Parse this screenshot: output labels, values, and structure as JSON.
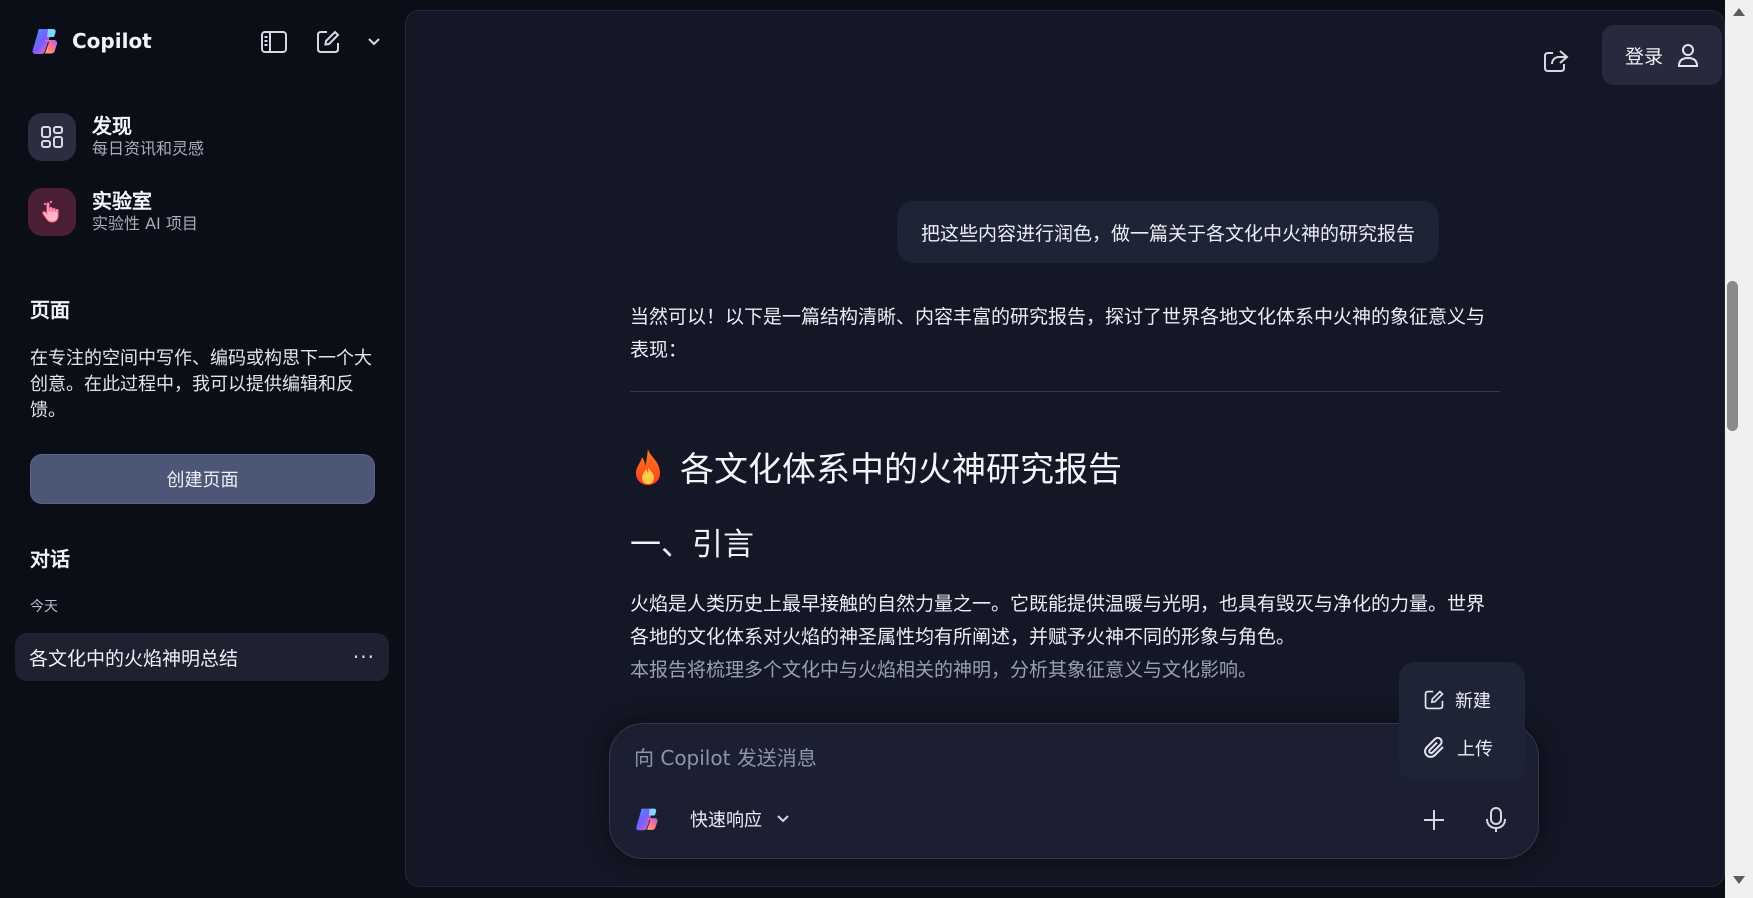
{
  "brand": {
    "name": "Copilot",
    "logo_icon": "copilot-logo-icon"
  },
  "sidebar": {
    "tools": [
      "sidebar-toggle-icon",
      "new-chat-icon",
      "chevron-down-icon"
    ],
    "discover": {
      "title": "发现",
      "subtitle": "每日资讯和灵感",
      "icon": "grid-icon"
    },
    "labs": {
      "title": "实验室",
      "subtitle": "实验性 AI 项目",
      "icon": "pointer-hand-icon"
    },
    "pages": {
      "title": "页面",
      "description": "在专注的空间中写作、编码或构思下一个大创意。在此过程中，我可以提供编辑和反馈。",
      "create_button": "创建页面"
    },
    "conversations": {
      "title": "对话",
      "today_label": "今天",
      "items": [
        {
          "title": "各文化中的火焰神明总结",
          "more": "···"
        }
      ]
    }
  },
  "header": {
    "share_icon": "share-icon",
    "login_label": "登录",
    "user_icon": "user-icon"
  },
  "chat": {
    "user_message": "把这些内容进行润色，做一篇关于各文化中火神的研究报告",
    "answer": {
      "intro": "当然可以！以下是一篇结构清晰、内容丰富的研究报告，探讨了世界各地文化体系中火神的象征意义与表现：",
      "report_title": "各文化体系中的火神研究报告",
      "section1_heading": "一、引言",
      "section1_para_line1": "火焰是人类历史上最早接触的自然力量之一。它既能提供温暖与光明，也具有毁灭与净化的力量。世界各地的文化体系对火焰的神圣属性均有所阐述，并赋予火神不同的形象与角色。",
      "section1_para_line2": "本报告将梳理多个文化中与火焰相关的神明，分析其象征意义与文化影响。"
    }
  },
  "composer": {
    "placeholder": "向 Copilot 发送消息",
    "mode_label": "快速响应",
    "plus_icon": "plus-icon",
    "mic_icon": "microphone-icon"
  },
  "popover": {
    "new_label": "新建",
    "upload_label": "上传"
  },
  "colors": {
    "background": "#0b0d17",
    "panel": "#141725",
    "accent_button": "#4c5676",
    "bubble": "#1f2336"
  }
}
